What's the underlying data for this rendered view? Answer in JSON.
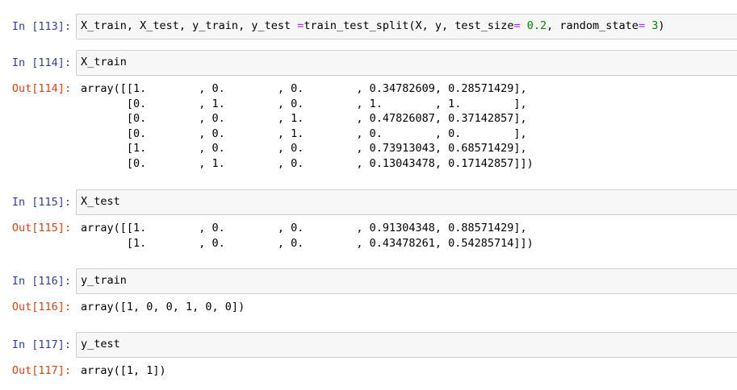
{
  "cells": [
    {
      "in_prompt": "In [113]:",
      "code": {
        "pre": "X_train, X_test, y_train, y_test ",
        "eq1": "=",
        "mid1": "train_test_split(X, y, test_size",
        "eq2": "=",
        "sp1": " ",
        "num1": "0.2",
        "mid2": ", random_state",
        "eq3": "=",
        "sp2": " ",
        "num2": "3",
        "post": ")"
      }
    },
    {
      "in_prompt": "In [114]:",
      "code_text": "X_train",
      "out_prompt": "Out[114]:",
      "output": "array([[1.        , 0.        , 0.        , 0.34782609, 0.28571429],\n       [0.        , 1.        , 0.        , 1.        , 1.        ],\n       [0.        , 0.        , 1.        , 0.47826087, 0.37142857],\n       [0.        , 0.        , 1.        , 0.        , 0.        ],\n       [1.        , 0.        , 0.        , 0.73913043, 0.68571429],\n       [0.        , 1.        , 0.        , 0.13043478, 0.17142857]])"
    },
    {
      "in_prompt": "In [115]:",
      "code_text": "X_test",
      "out_prompt": "Out[115]:",
      "output": "array([[1.        , 0.        , 0.        , 0.91304348, 0.88571429],\n       [1.        , 0.        , 0.        , 0.43478261, 0.54285714]])"
    },
    {
      "in_prompt": "In [116]:",
      "code_text": "y_train",
      "out_prompt": "Out[116]:",
      "output": "array([1, 0, 0, 1, 0, 0])"
    },
    {
      "in_prompt": "In [117]:",
      "code_text": "y_test",
      "out_prompt": "Out[117]:",
      "output": "array([1, 1])"
    }
  ],
  "colors": {
    "in_prompt": "#303f9f",
    "out_prompt": "#d84315",
    "operator": "#aa22ff",
    "number": "#008800",
    "input_bg": "#f7f7f7",
    "input_border": "#cfcfcf"
  }
}
